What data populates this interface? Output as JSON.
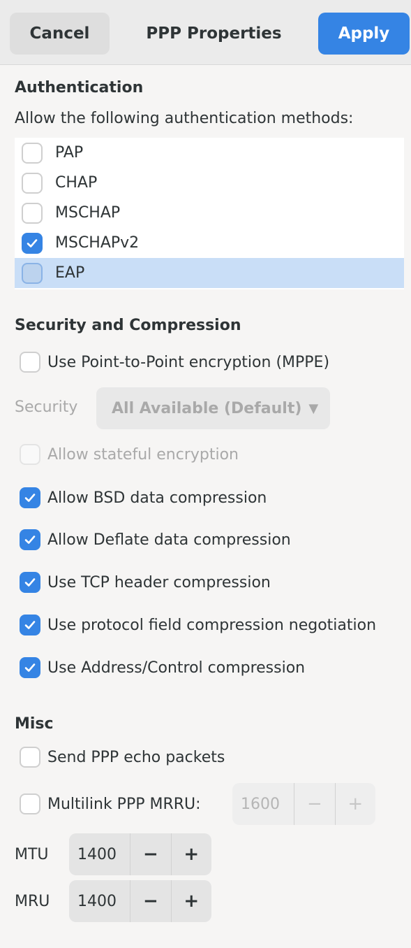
{
  "header": {
    "cancel_label": "Cancel",
    "title": "PPP Properties",
    "apply_label": "Apply"
  },
  "authentication": {
    "title": "Authentication",
    "subtitle": "Allow the following authentication methods:",
    "methods": [
      {
        "label": "PAP",
        "checked": false
      },
      {
        "label": "CHAP",
        "checked": false
      },
      {
        "label": "MSCHAP",
        "checked": false
      },
      {
        "label": "MSCHAPv2",
        "checked": true
      },
      {
        "label": "EAP",
        "checked": false,
        "selected": true
      }
    ]
  },
  "security": {
    "title": "Security and Compression",
    "mppe_label": "Use Point-to-Point encryption (MPPE)",
    "security_label": "Security",
    "security_value": "All Available (Default)",
    "stateful_label": "Allow stateful encryption",
    "bsd_label": "Allow BSD data compression",
    "deflate_label": "Allow Deflate data compression",
    "tcp_label": "Use TCP header compression",
    "protocol_label": "Use protocol field compression negotiation",
    "address_label": "Use Address/Control compression"
  },
  "misc": {
    "title": "Misc",
    "echo_label": "Send PPP echo packets",
    "multilink_label": "Multilink PPP MRRU:",
    "mrru_value": "1600",
    "mtu_label": "MTU",
    "mtu_value": "1400",
    "mru_label": "MRU",
    "mru_value": "1400",
    "minus": "−",
    "plus": "+"
  },
  "colors": {
    "accent": "#3584e4",
    "selection": "#c9def7"
  }
}
